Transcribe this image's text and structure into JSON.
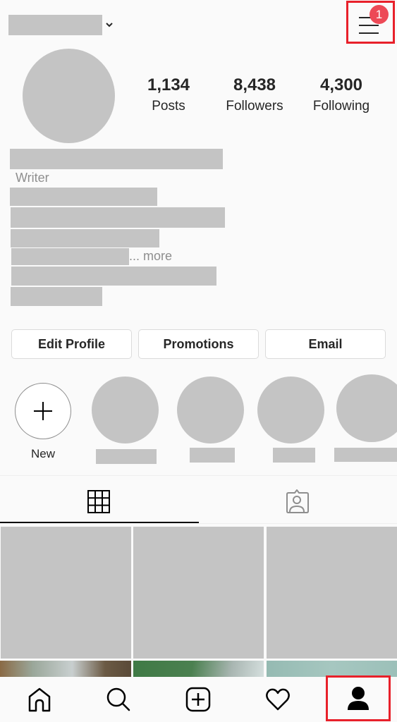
{
  "header": {
    "username_redacted": true,
    "chevron_icon": "chevron-down-icon",
    "menu_icon": "hamburger-menu-icon",
    "notification_badge": "1",
    "highlight_color": "#e8202a",
    "badge_color": "#ed4956"
  },
  "profile": {
    "stats": [
      {
        "value": "1,134",
        "label": "Posts"
      },
      {
        "value": "8,438",
        "label": "Followers"
      },
      {
        "value": "4,300",
        "label": "Following"
      }
    ],
    "category": "Writer",
    "more_link": "... more"
  },
  "actions": {
    "edit_profile": "Edit Profile",
    "promotions": "Promotions",
    "email": "Email"
  },
  "highlights": {
    "new_label": "New",
    "items_count": 4
  },
  "tabs": [
    {
      "name": "grid",
      "icon": "grid-icon",
      "active": true
    },
    {
      "name": "tagged",
      "icon": "tagged-person-icon",
      "active": false
    }
  ],
  "bottom_nav": [
    {
      "name": "home",
      "icon": "home-icon"
    },
    {
      "name": "search",
      "icon": "search-icon"
    },
    {
      "name": "new-post",
      "icon": "add-post-icon"
    },
    {
      "name": "activity",
      "icon": "heart-icon"
    },
    {
      "name": "profile",
      "icon": "profile-icon",
      "selected": true
    }
  ]
}
